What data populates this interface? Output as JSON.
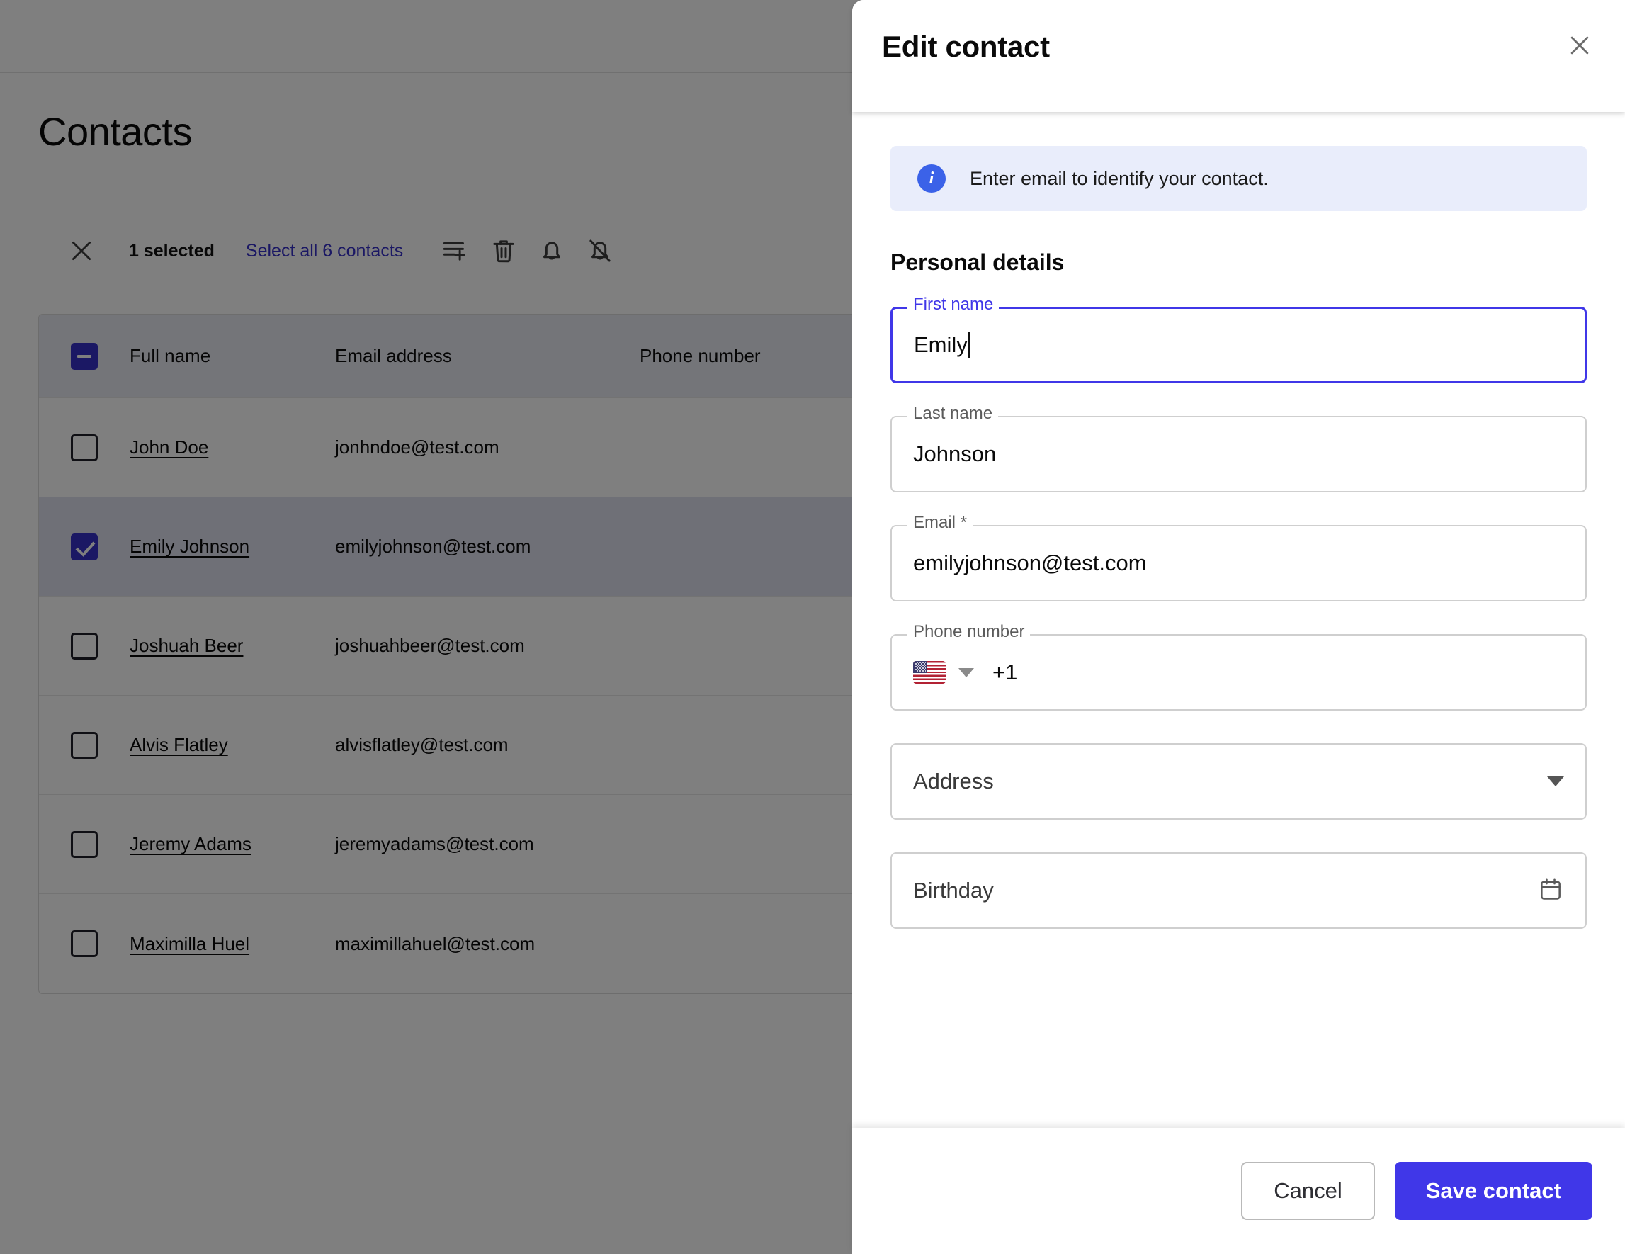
{
  "page": {
    "title": "Contacts"
  },
  "selection_toolbar": {
    "close_icon": "close-icon",
    "count_label": "1 selected",
    "select_all_label": "Select all 6 contacts",
    "actions": [
      {
        "name": "playlist-add-icon",
        "label": "Add to list"
      },
      {
        "name": "trash-icon",
        "label": "Delete"
      },
      {
        "name": "bell-icon",
        "label": "Enable notifications"
      },
      {
        "name": "bell-off-icon",
        "label": "Disable notifications"
      }
    ]
  },
  "table": {
    "header_checkbox_state": "indeterminate",
    "columns": [
      "Full name",
      "Email address",
      "Phone number"
    ],
    "rows": [
      {
        "checked": false,
        "name": "John Doe",
        "email": "jonhndoe@test.com",
        "phone": ""
      },
      {
        "checked": true,
        "name": "Emily Johnson",
        "email": "emilyjohnson@test.com",
        "phone": ""
      },
      {
        "checked": false,
        "name": "Joshuah Beer",
        "email": "joshuahbeer@test.com",
        "phone": ""
      },
      {
        "checked": false,
        "name": "Alvis Flatley",
        "email": "alvisflatley@test.com",
        "phone": ""
      },
      {
        "checked": false,
        "name": "Jeremy Adams",
        "email": "jeremyadams@test.com",
        "phone": ""
      },
      {
        "checked": false,
        "name": "Maximilla Huel",
        "email": "maximillahuel@test.com",
        "phone": ""
      }
    ]
  },
  "dialog": {
    "title": "Edit contact",
    "close_icon": "close-icon",
    "banner": {
      "icon": "info-icon",
      "text": "Enter email to identify your contact."
    },
    "section_title": "Personal details",
    "fields": {
      "first_name": {
        "label": "First name",
        "value": "Emily",
        "focused": true
      },
      "last_name": {
        "label": "Last name",
        "value": "Johnson"
      },
      "email": {
        "label": "Email *",
        "value": "emilyjohnson@test.com"
      },
      "phone": {
        "label": "Phone number",
        "flag": "us-flag-icon",
        "dial_code": "+1",
        "value": ""
      },
      "address": {
        "placeholder": "Address",
        "adornment": "chevron-down-icon"
      },
      "birthday": {
        "placeholder": "Birthday",
        "adornment": "calendar-icon"
      }
    },
    "footer": {
      "cancel_label": "Cancel",
      "save_label": "Save contact"
    }
  },
  "colors": {
    "accent": "#4037e8",
    "link": "#3730c8",
    "checkbox_checked": "#3730c8",
    "banner_bg": "#e9edfb",
    "table_header_bg": "#e9eaf3",
    "selected_row_bg": "#dfe0ef"
  }
}
